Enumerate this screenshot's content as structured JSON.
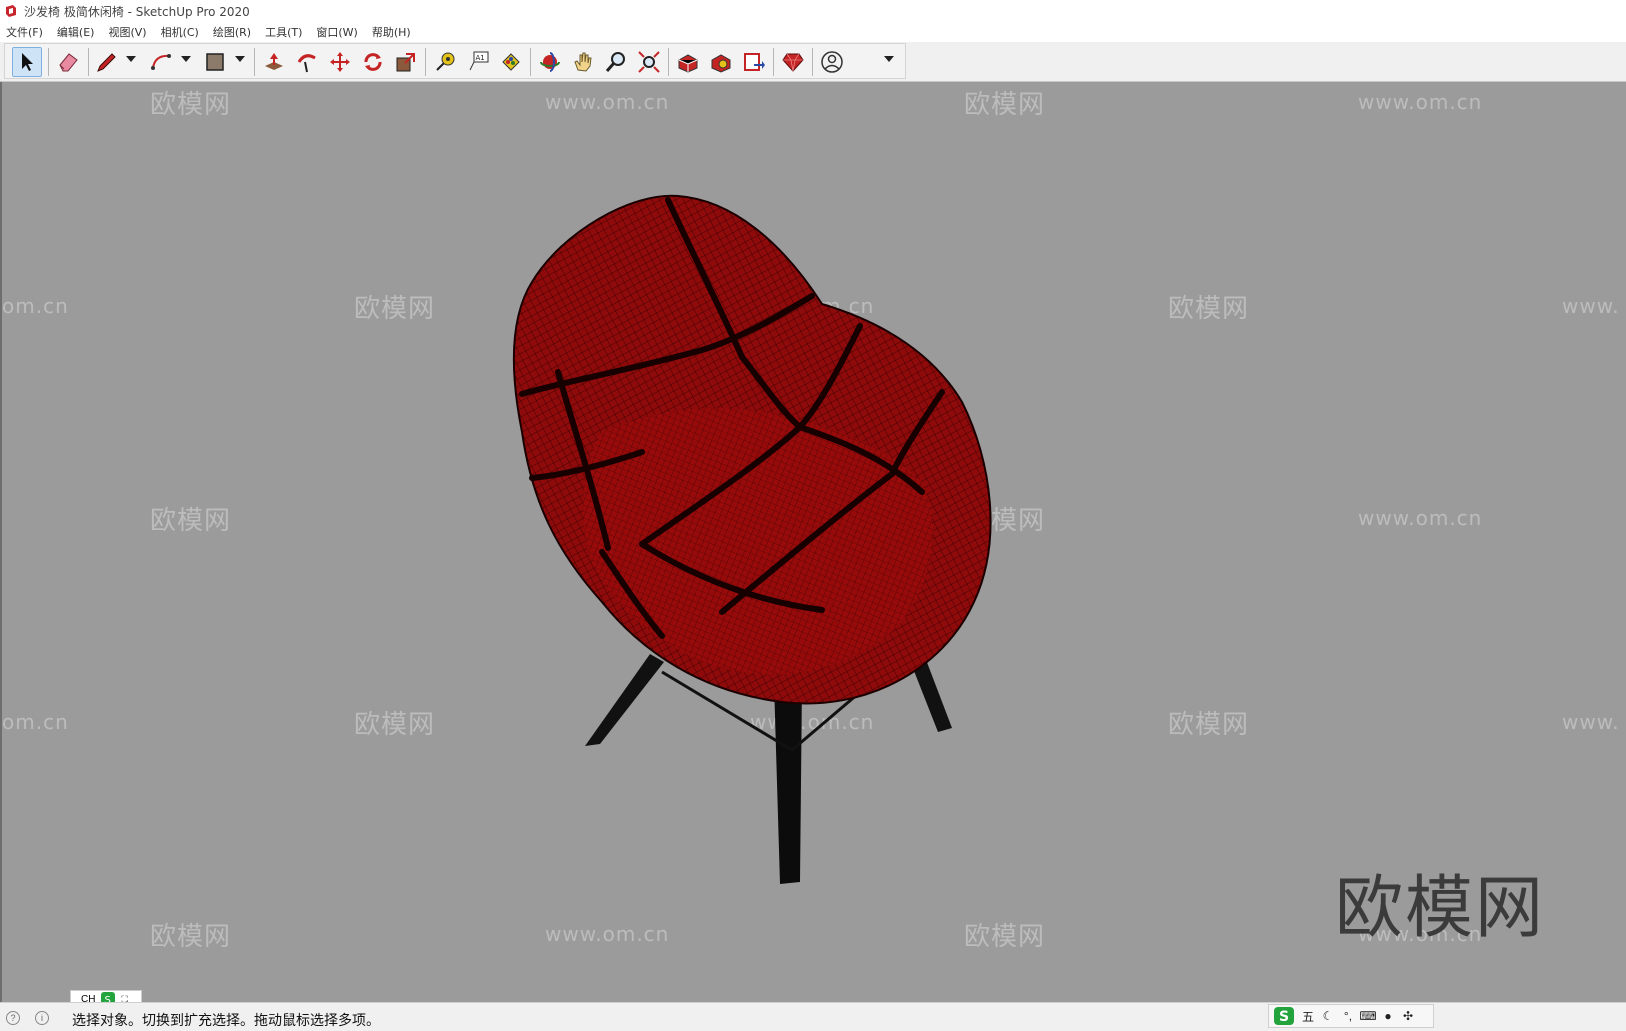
{
  "window": {
    "title": "沙发椅 极简休闲椅 - SketchUp Pro 2020"
  },
  "menu": [
    {
      "label": "文件(F)"
    },
    {
      "label": "编辑(E)"
    },
    {
      "label": "视图(V)"
    },
    {
      "label": "相机(C)"
    },
    {
      "label": "绘图(R)"
    },
    {
      "label": "工具(T)"
    },
    {
      "label": "窗口(W)"
    },
    {
      "label": "帮助(H)"
    }
  ],
  "toolbar": {
    "tools": [
      {
        "icon": "select-arrow-icon",
        "active": true
      },
      {
        "icon": "eraser-icon"
      },
      {
        "icon": "pencil-line-icon",
        "dropdown": true
      },
      {
        "icon": "arc-icon",
        "dropdown": true
      },
      {
        "icon": "rectangle-icon",
        "dropdown": true
      },
      {
        "icon": "push-pull-icon"
      },
      {
        "icon": "follow-me-icon"
      },
      {
        "icon": "move-icon"
      },
      {
        "icon": "rotate-icon"
      },
      {
        "icon": "scale-icon"
      },
      {
        "icon": "tape-measure-icon"
      },
      {
        "icon": "text-label-icon"
      },
      {
        "icon": "paint-bucket-icon"
      },
      {
        "icon": "orbit-icon"
      },
      {
        "icon": "pan-hand-icon"
      },
      {
        "icon": "zoom-icon"
      },
      {
        "icon": "zoom-extents-icon"
      },
      {
        "icon": "3d-warehouse-icon"
      },
      {
        "icon": "extension-warehouse-icon"
      },
      {
        "icon": "layout-send-icon"
      },
      {
        "icon": "ruby-extension-icon"
      },
      {
        "icon": "account-icon",
        "dropdown": true
      }
    ],
    "text_tool_glyph": "A1"
  },
  "watermarks": {
    "brand": "欧模网",
    "url": "www.om.cn",
    "url_fragment_left": "om.cn",
    "url_fragment_right": "www.",
    "big_brand": "欧模网"
  },
  "model": {
    "description_color_seat": "#8f0a0a",
    "description_color_legs": "#111111",
    "background": "#9b9b9b"
  },
  "status": {
    "message": "选择对象。切换到扩充选择。拖动鼠标选择多项。"
  },
  "ime": {
    "mini_lang": "CH",
    "mode_label": "五"
  }
}
